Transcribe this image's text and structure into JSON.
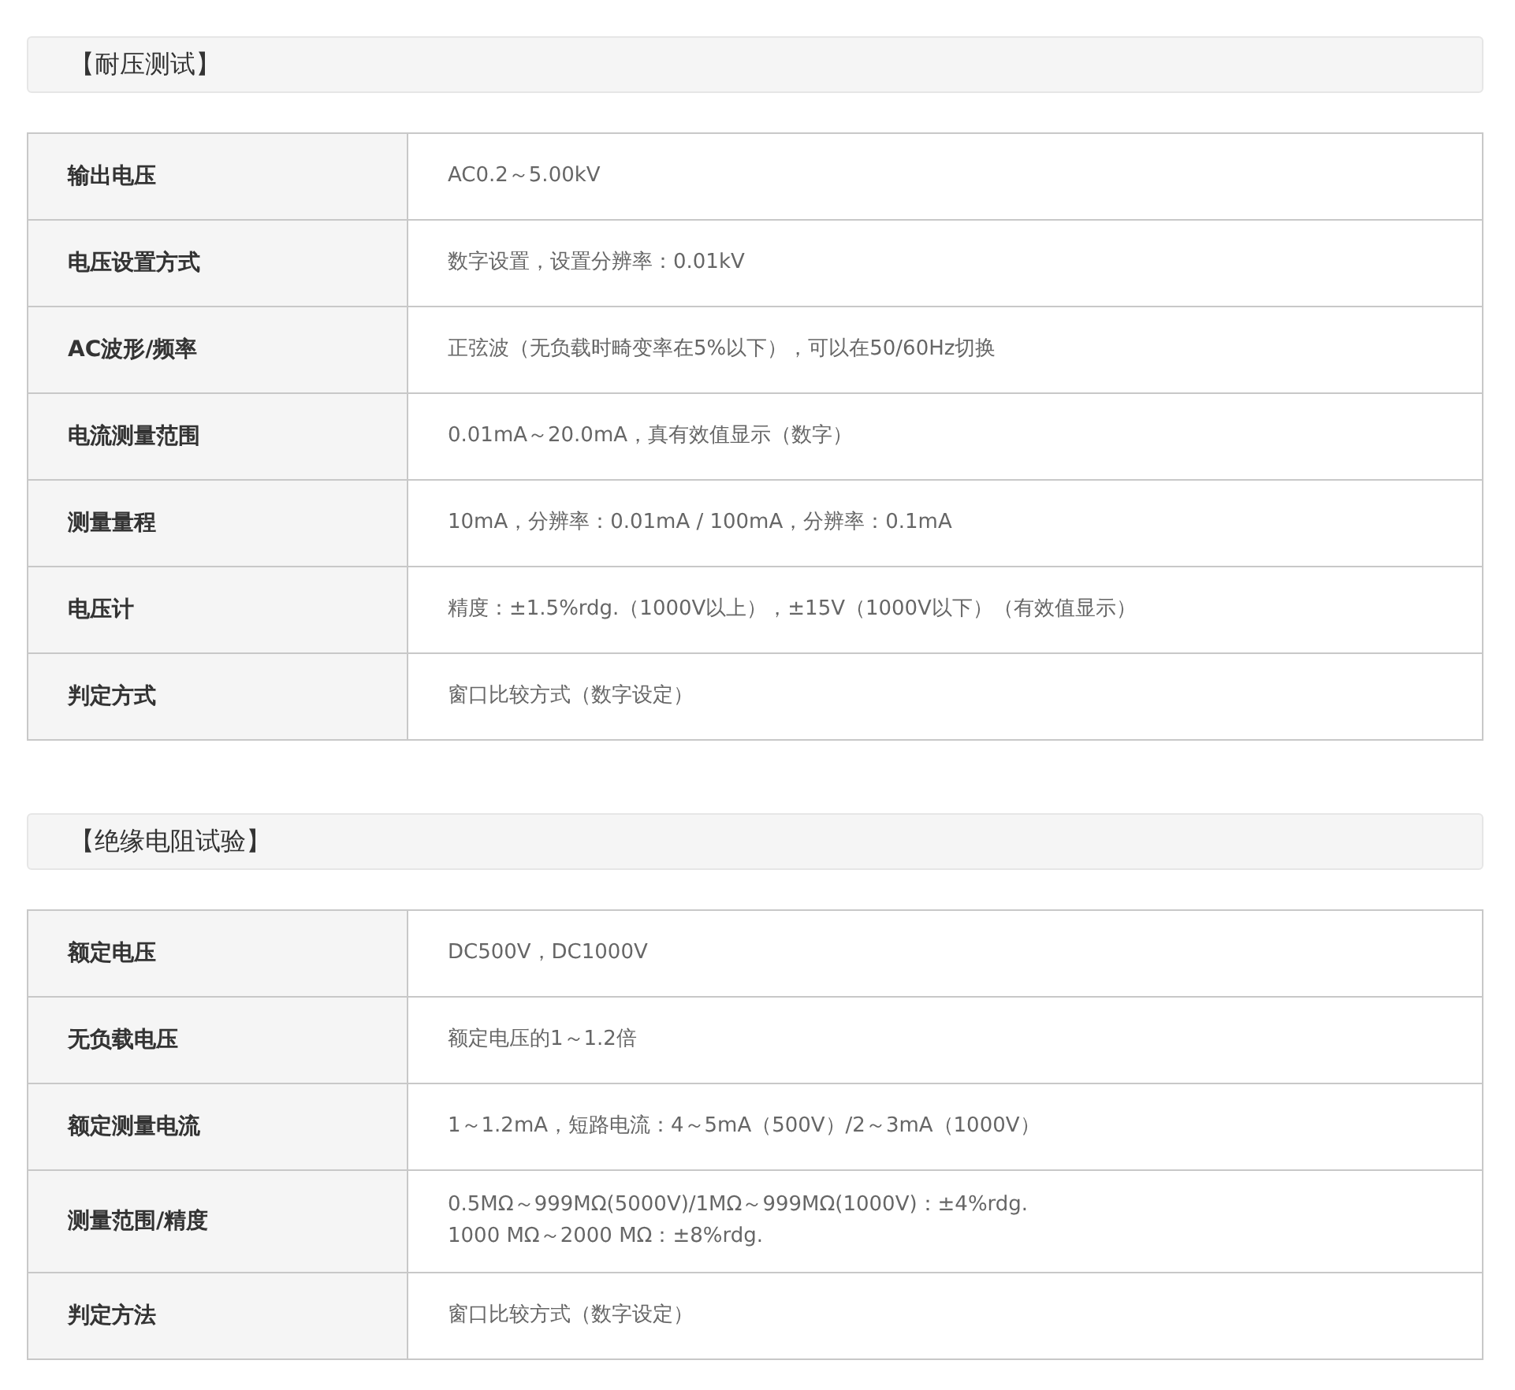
{
  "sections": [
    {
      "title": "【耐压测试】",
      "rows": [
        {
          "label": "输出电压",
          "value": "AC0.2～5.00kV"
        },
        {
          "label": "电压设置方式",
          "value": "数字设置，设置分辨率：0.01kV"
        },
        {
          "label": "AC波形/频率",
          "value": "正弦波（无负载时畸变率在5%以下），可以在50/60Hz切换"
        },
        {
          "label": "电流测量范围",
          "value": "0.01mA～20.0mA，真有效值显示（数字）"
        },
        {
          "label": "测量量程",
          "value": "10mA，分辨率：0.01mA / 100mA，分辨率：0.1mA"
        },
        {
          "label": "电压计",
          "value": "精度：±1.5%rdg.（1000V以上），±15V（1000V以下）（有效值显示）"
        },
        {
          "label": "判定方式",
          "value": "窗口比较方式（数字设定）"
        }
      ]
    },
    {
      "title": "【绝缘电阻试验】",
      "rows": [
        {
          "label": "额定电压",
          "value": "DC500V，DC1000V"
        },
        {
          "label": "无负载电压",
          "value": "额定电压的1～1.2倍"
        },
        {
          "label": "额定测量电流",
          "value": "1～1.2mA，短路电流：4～5mA（500V）/2～3mA（1000V）"
        },
        {
          "label": "测量范围/精度",
          "value": "0.5MΩ～999MΩ(5000V)/1MΩ～999MΩ(1000V)：±4%rdg.\n1000 MΩ～2000 MΩ：±8%rdg."
        },
        {
          "label": "判定方法",
          "value": "窗口比较方式（数字设定）"
        }
      ]
    }
  ]
}
